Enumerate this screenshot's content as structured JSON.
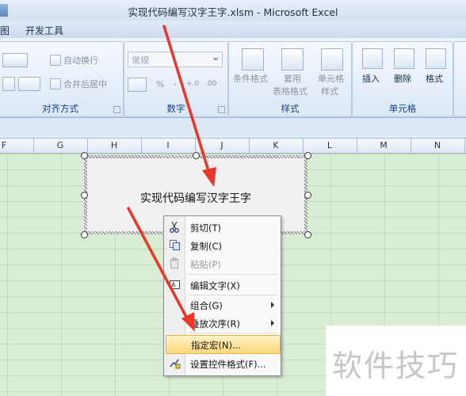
{
  "window": {
    "title": "实现代码编写汉字王字.xlsm - Microsoft Excel"
  },
  "ribbon_tabs": [
    {
      "label": "图"
    },
    {
      "label": "开发工具"
    }
  ],
  "ribbon": {
    "alignment": {
      "wrap_text": "自动换行",
      "merge_center": "合并后居中",
      "label": "对齐方式"
    },
    "number": {
      "format_value": "常规",
      "percent": "%",
      "comma": ",",
      "inc_decimal": "+.0",
      "dec_decimal": ".00",
      "label": "数字"
    },
    "styles": {
      "conditional": "条件格式",
      "table_line1": "套用",
      "table_line2": "表格格式",
      "cell_line1": "单元格",
      "cell_line2": "样式",
      "label": "样式"
    },
    "cells": {
      "insert": "插入",
      "delete": "删除",
      "format": "格式",
      "label": "单元格"
    }
  },
  "columns": [
    "F",
    "G",
    "H",
    "I",
    "J",
    "K",
    "L",
    "M",
    "N"
  ],
  "shape": {
    "text": "实现代码编写汉字王字"
  },
  "context_menu": {
    "items": [
      {
        "label": "剪切(T)",
        "icon": "scissors-icon"
      },
      {
        "label": "复制(C)",
        "icon": "copy-icon"
      },
      {
        "label": "粘贴(P)",
        "icon": "paste-icon",
        "disabled": true
      },
      {
        "label": "编辑文字(X)",
        "icon": "edit-text-icon"
      },
      {
        "label": "组合(G)",
        "submenu": true
      },
      {
        "label": "叠放次序(R)",
        "submenu": true
      },
      {
        "label": "指定宏(N)...",
        "highlighted": true
      },
      {
        "label": "设置控件格式(F)...",
        "icon": "format-control-icon"
      }
    ]
  },
  "watermark": {
    "text": "软件技巧"
  },
  "colors": {
    "grid_bg": "#d9ecd4",
    "highlight": "#ffd87a",
    "arrow": "#e8382a"
  }
}
